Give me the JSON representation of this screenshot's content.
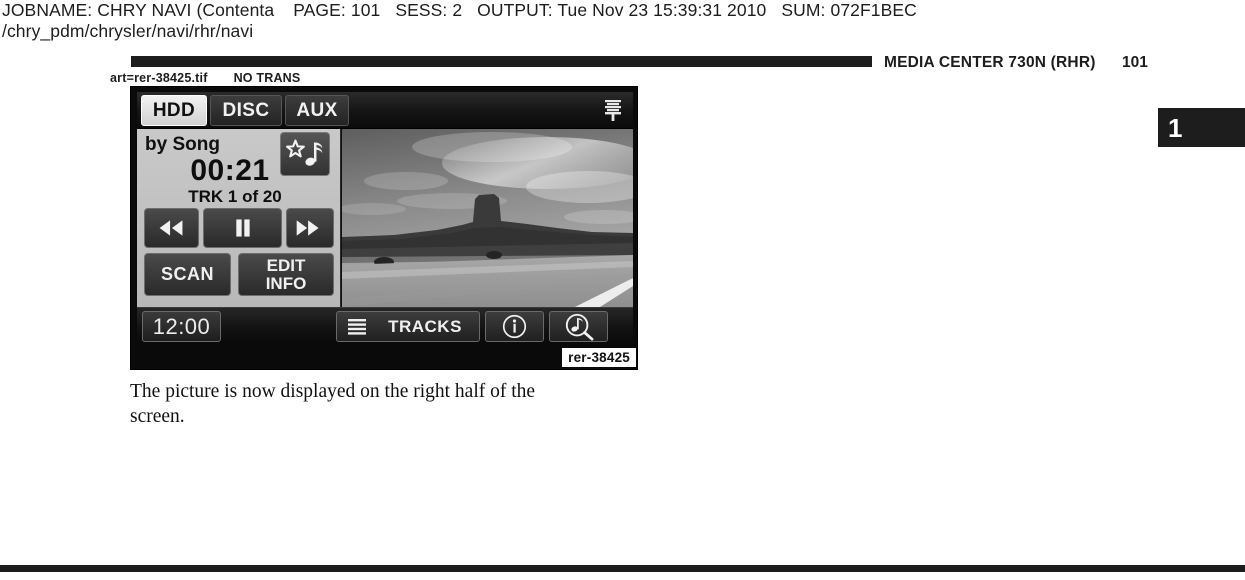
{
  "job_header": {
    "jobname_label": "JOBNAME:",
    "jobname_value": "CHRY NAVI (Contenta",
    "page_label": "PAGE:",
    "page_value": "101",
    "sess_label": "SESS:",
    "sess_value": "2",
    "output_label": "OUTPUT:",
    "output_value": "Tue Nov 23 15:39:31 2010",
    "sum_label": "SUM:",
    "sum_value": "072F1BEC",
    "path": "/chry_pdm/chrysler/navi/rhr/navi"
  },
  "running_head": {
    "title": "MEDIA CENTER 730N (RHR)",
    "page_number": "101"
  },
  "art_marker": {
    "art": "art=rer-38425.tif",
    "trans": "NO TRANS"
  },
  "chapter_tab": {
    "number": "1"
  },
  "media_screen": {
    "sources": [
      {
        "label": "HDD",
        "selected": true
      },
      {
        "label": "DISC",
        "selected": false
      },
      {
        "label": "AUX",
        "selected": false
      }
    ],
    "equalizer_icon": "equalizer-icon",
    "info_panel": {
      "sort_mode": "by Song",
      "elapsed_time": "00:21",
      "track_position": "TRK 1 of 20",
      "favorite_icon": "star-music-note-icon",
      "transport": [
        {
          "name": "previous",
          "icon": "rewind-icon"
        },
        {
          "name": "play-pause",
          "icon": "pause-icon"
        },
        {
          "name": "next",
          "icon": "fast-forward-icon"
        }
      ],
      "scan_label": "SCAN",
      "edit_info_label_line1": "EDIT",
      "edit_info_label_line2": "INFO"
    },
    "picture": {
      "description": "grayscale photo of a butte beside a highway"
    },
    "bottom_bar": {
      "clock": "12:00",
      "tracks_label": "TRACKS",
      "tracks_icon": "list-icon",
      "info_icon": "info-circle-icon",
      "search_icon": "music-search-icon"
    },
    "art_id": "rer-38425"
  },
  "caption": {
    "line1": "The picture is now displayed on the right half of the",
    "line2": "screen."
  },
  "colors": {
    "ink": "#1d1d1d",
    "paper": "#ffffff",
    "screen_bezel": "#0a0a0a",
    "panel_light": "#c9c9c9"
  }
}
